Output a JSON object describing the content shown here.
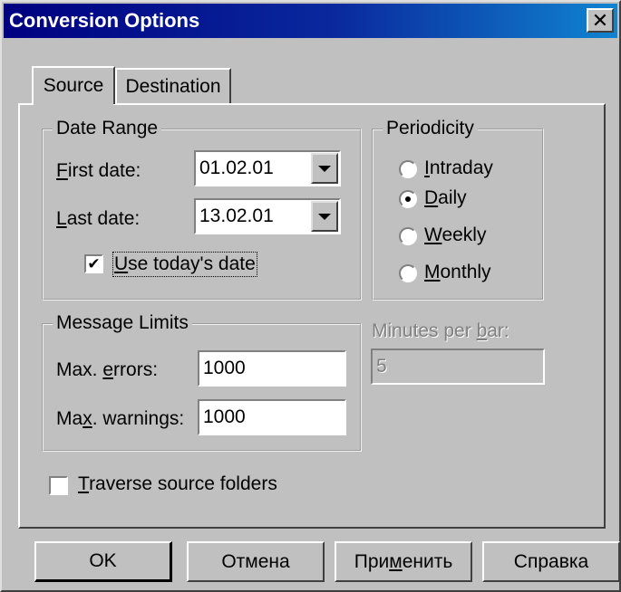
{
  "window": {
    "title": "Conversion Options",
    "close_glyph": "✕"
  },
  "tabs": [
    {
      "label": "Source",
      "selected": true
    },
    {
      "label": "Destination",
      "selected": false
    }
  ],
  "date_range": {
    "legend": "Date Range",
    "first_date_label_pre": "",
    "first_date_label_key": "F",
    "first_date_label_post": "irst date:",
    "first_date_value": "01.02.01",
    "last_date_label_pre": "",
    "last_date_label_key": "L",
    "last_date_label_post": "ast date:",
    "last_date_value": "13.02.01",
    "use_today_pre": "",
    "use_today_key": "U",
    "use_today_post": "se today's date",
    "use_today_checked": true,
    "check_glyph": "✔"
  },
  "periodicity": {
    "legend": "Periodicity",
    "options": [
      {
        "pre": "",
        "key": "I",
        "post": "ntraday",
        "checked": false
      },
      {
        "pre": "",
        "key": "D",
        "post": "aily",
        "checked": true
      },
      {
        "pre": "",
        "key": "W",
        "post": "eekly",
        "checked": false
      },
      {
        "pre": "",
        "key": "M",
        "post": "onthly",
        "checked": false
      }
    ]
  },
  "minutes_per_bar": {
    "label_pre": "Minutes per ",
    "label_key": "b",
    "label_post": "ar:",
    "value": "5",
    "enabled": false
  },
  "message_limits": {
    "legend": "Message Limits",
    "max_errors_pre": "Max. ",
    "max_errors_key": "e",
    "max_errors_post": "rrors:",
    "max_errors_value": "1000",
    "max_warnings_pre": "Ma",
    "max_warnings_key": "x",
    "max_warnings_post": ". warnings:",
    "max_warnings_value": "1000"
  },
  "traverse": {
    "pre": "",
    "key": "T",
    "post": "raverse source folders",
    "checked": false
  },
  "buttons": {
    "ok": "OK",
    "cancel": "Отмена",
    "apply_pre": "При",
    "apply_key": "м",
    "apply_post": "енить",
    "help": "Справка"
  }
}
